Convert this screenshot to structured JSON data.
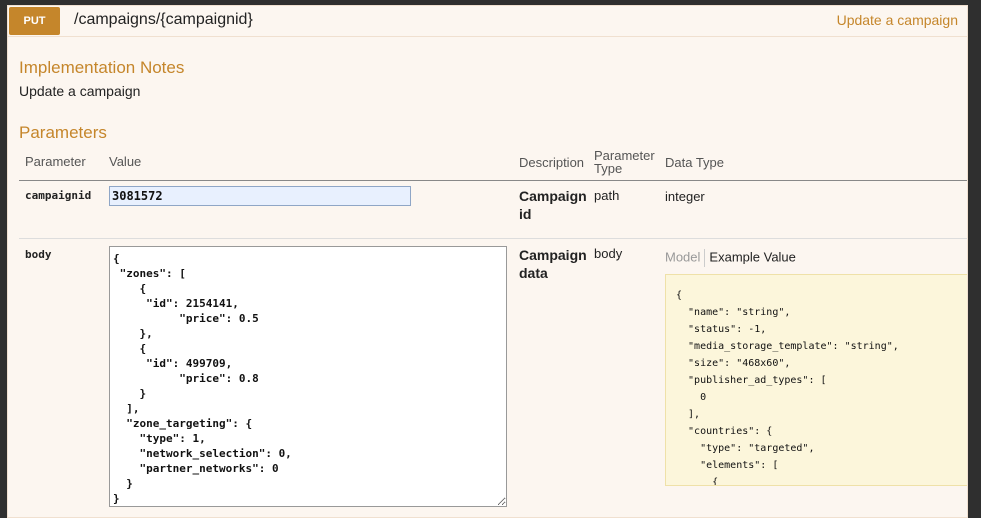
{
  "operation": {
    "method": "PUT",
    "path": "/campaigns/{campaignid}",
    "summary": "Update a campaign"
  },
  "implementation_notes": {
    "heading": "Implementation Notes",
    "text": "Update a campaign"
  },
  "parameters": {
    "heading": "Parameters",
    "columns": {
      "parameter": "Parameter",
      "value": "Value",
      "description": "Description",
      "parameter_type_line1": "Parameter",
      "parameter_type_line2": "Type",
      "data_type": "Data Type"
    },
    "rows": [
      {
        "name": "campaignid",
        "value": "3081572",
        "description_line1": "Campaign",
        "description_line2": "id",
        "param_type": "path",
        "data_type": "integer"
      },
      {
        "name": "body",
        "value": "{\n \"zones\": [\n    {\n     \"id\": 2154141,\n          \"price\": 0.5\n    },\n    {\n     \"id\": 499709,\n          \"price\": 0.8\n    }\n  ],\n  \"zone_targeting\": {\n    \"type\": 1,\n    \"network_selection\": 0,\n    \"partner_networks\": 0\n  }\n}",
        "description_line1": "Campaign",
        "description_line2": "data",
        "param_type": "body",
        "model_tab": "Model",
        "example_tab": "Example Value",
        "example_value": "{\n  \"name\": \"string\",\n  \"status\": -1,\n  \"media_storage_template\": \"string\",\n  \"size\": \"468x60\",\n  \"publisher_ad_types\": [\n    0\n  ],\n  \"countries\": {\n    \"type\": \"targeted\",\n    \"elements\": [\n      {"
      }
    ]
  }
}
